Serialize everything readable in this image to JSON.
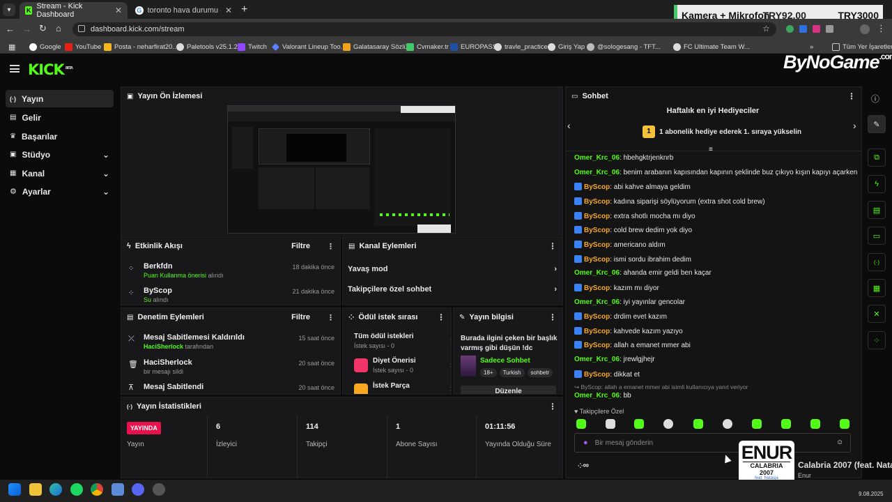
{
  "browser": {
    "tabs": [
      {
        "title": "Stream - Kick Dashboard"
      },
      {
        "title": "toronto hava durumu - Google"
      }
    ],
    "url": "dashboard.kick.com/stream",
    "bookmarks": [
      "Google",
      "YouTube",
      "Posta - neharfirat20...",
      "Paletools v25.1.23",
      "Twitch",
      "Valorant Lineup Too...",
      "Galatasaray Sözlük",
      "Cvmaker.tr",
      "EUROPASS",
      "travle_practice",
      "Giriş Yap",
      "@sologesang - TFT...",
      "FC Ultimate Team W..."
    ],
    "bookmarks_folder": "Tüm Yer İşaretleri"
  },
  "overlay": {
    "camera_label": "Kamera + Mikrofon",
    "price1": "TRY92.00",
    "price2": "TRY3000",
    "brand": "ByNoGame",
    "brand_suffix": ".com"
  },
  "kick": {
    "logo": "KICK",
    "beta": "BETA",
    "sidebar": [
      {
        "label": "Yayın",
        "active": true
      },
      {
        "label": "Gelir"
      },
      {
        "label": "Başarılar"
      },
      {
        "label": "Stüdyo"
      },
      {
        "label": "Kanal"
      },
      {
        "label": "Ayarlar"
      }
    ],
    "preview_title": "Yayın Ön İzlemesi",
    "activity": {
      "title": "Etkinlik Akışı",
      "filter": "Filtre",
      "items": [
        {
          "name": "Berkfdn",
          "detail": "Puan Kullanma önerisi",
          "suffix": "alındı",
          "time": "18 dakika önce"
        },
        {
          "name": "ByScop",
          "detail": "Su",
          "suffix": "alındı",
          "time": "21 dakika önce"
        }
      ]
    },
    "channel_actions": {
      "title": "Kanal Eylemleri",
      "items": [
        "Yavaş mod",
        "Takipçilere özel sohbet"
      ]
    },
    "moderation": {
      "title": "Denetim Eylemleri",
      "filter": "Filtre",
      "items": [
        {
          "title": "Mesaj Sabitlemesi Kaldırıldı",
          "user": "HaciSherlock",
          "suffix": "tarafından",
          "time": "15 saat önce"
        },
        {
          "title": "HaciSherlock",
          "sub": "bir mesajı sildi",
          "time": "20 saat önce"
        },
        {
          "title": "Mesaj Sabitlendi",
          "time": "20 saat önce"
        }
      ]
    },
    "rewards": {
      "title": "Ödül istek sırası",
      "items": [
        {
          "title": "Tüm ödül istekleri",
          "sub": "İstek sayısı - 0"
        },
        {
          "title": "Diyet Önerisi",
          "sub": "İstek sayısı - 0"
        },
        {
          "title": "İstek Parça",
          "sub": ""
        }
      ]
    },
    "stream_info": {
      "title": "Yayın bilgisi",
      "stream_title": "Burada ilgini çeken bir başlık varmış gibi düşün !dc",
      "category": "Sadece Sohbet",
      "tags": [
        "18+",
        "Turkish",
        "sohbetr"
      ],
      "edit": "Düzenle"
    },
    "stats": {
      "title": "Yayın İstatistikleri",
      "live_badge": "YAYINDA",
      "cols": [
        {
          "value": "",
          "label": "Yayın"
        },
        {
          "value": "6",
          "label": "İzleyici"
        },
        {
          "value": "114",
          "label": "Takipçi"
        },
        {
          "value": "1",
          "label": "Abone Sayısı"
        },
        {
          "value": "01:11:56",
          "label": "Yayında Olduğu Süre"
        }
      ]
    },
    "chat": {
      "title": "Sohbet",
      "top_gifters_title": "Haftalık en iyi Hediyeciler",
      "top_gifters_rank": "1",
      "top_gifters_text": "1 abonelik hediye ederek 1. sıraya yükselin",
      "messages": [
        {
          "user": "Omer_Krc_06",
          "color": "green",
          "text": ": hbehgktrjenknrb"
        },
        {
          "user": "Omer_Krc_06",
          "color": "green",
          "text": ": benim arabanın kapısından kapının şeklinde buz çıkıyo kışın kapıyı açarken"
        },
        {
          "user": "ByScop",
          "color": "orange",
          "text": ": abi kahve almaya geldim"
        },
        {
          "user": "ByScop",
          "color": "orange",
          "text": ": kadına siparişi söylüyorum (extra shot cold brew)"
        },
        {
          "user": "ByScop",
          "color": "orange",
          "text": ": extra shotlı mocha mı diyo"
        },
        {
          "user": "ByScop",
          "color": "orange",
          "text": ": cold brew dedim yok diyo"
        },
        {
          "user": "ByScop",
          "color": "orange",
          "text": ": americano aldım"
        },
        {
          "user": "ByScop",
          "color": "orange",
          "text": ": ismi sordu ibrahim dedim"
        },
        {
          "user": "Omer_Krc_06",
          "color": "green",
          "text": ": ahanda emir geldi ben kaçar"
        },
        {
          "user": "ByScop",
          "color": "orange",
          "text": ": kazım mı diyor"
        },
        {
          "user": "Omer_Krc_06",
          "color": "green",
          "text": ": iyi yayınlar gencolar"
        },
        {
          "user": "ByScop",
          "color": "orange",
          "text": ": drdim evet kazım"
        },
        {
          "user": "ByScop",
          "color": "orange",
          "text": ": kahvede kazım yazıyo"
        },
        {
          "user": "ByScop",
          "color": "orange",
          "text": ": allah a emanet mmer abi"
        },
        {
          "user": "Omer_Krc_06",
          "color": "green",
          "text": ": jrewlgjhejr"
        },
        {
          "user": "ByScop",
          "color": "orange",
          "text": ": dikkat et"
        }
      ],
      "reply_context": "ByScop: allah a emanet mmer abi isimli kullanıcıya yanıt veriyor",
      "last_message": {
        "user": "Omer_Krc_06",
        "text": ": bb"
      },
      "followers_only": "Takipçilere Özel",
      "input_placeholder": "Bir mesaj gönderin",
      "points": "∞"
    }
  },
  "now_playing": {
    "artist_logo": "ENUR",
    "album_text": "CALABRIA 2007",
    "album_sub": "feat. Natasja",
    "title": "Calabria 2007 (feat. Nata",
    "artist": "Enur"
  },
  "taskbar": {
    "date": "9.08.2025"
  },
  "colors": {
    "kick_green": "#53fc18",
    "orange": "#f7a823",
    "live_red": "#e9114c"
  }
}
